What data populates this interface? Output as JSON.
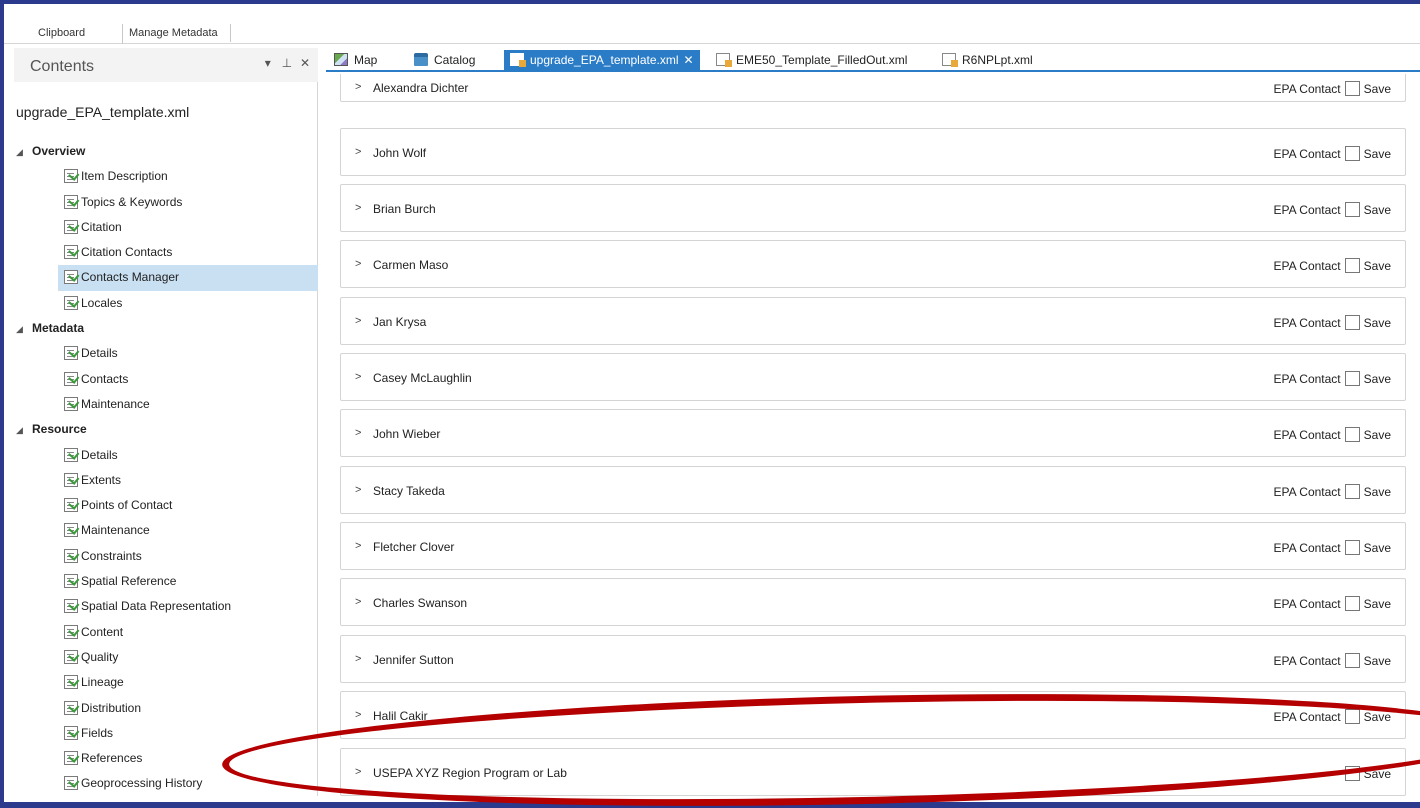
{
  "ribbon": {
    "groups": [
      "Clipboard",
      "Manage Metadata"
    ]
  },
  "contents_pane": {
    "title": "Contents",
    "controls": [
      "▾",
      "⊥",
      "✕"
    ],
    "document_name": "upgrade_EPA_template.xml",
    "tree": [
      {
        "type": "group",
        "label": "Overview"
      },
      {
        "type": "item",
        "label": "Item Description"
      },
      {
        "type": "item",
        "label": "Topics & Keywords"
      },
      {
        "type": "item",
        "label": "Citation"
      },
      {
        "type": "item",
        "label": "Citation Contacts"
      },
      {
        "type": "item",
        "label": "Contacts Manager",
        "selected": true
      },
      {
        "type": "item",
        "label": "Locales"
      },
      {
        "type": "group",
        "label": "Metadata"
      },
      {
        "type": "item",
        "label": "Details"
      },
      {
        "type": "item",
        "label": "Contacts"
      },
      {
        "type": "item",
        "label": "Maintenance"
      },
      {
        "type": "group",
        "label": "Resource"
      },
      {
        "type": "item",
        "label": "Details"
      },
      {
        "type": "item",
        "label": "Extents"
      },
      {
        "type": "item",
        "label": "Points of Contact"
      },
      {
        "type": "item",
        "label": "Maintenance"
      },
      {
        "type": "item",
        "label": "Constraints"
      },
      {
        "type": "item",
        "label": "Spatial Reference"
      },
      {
        "type": "item",
        "label": "Spatial Data Representation"
      },
      {
        "type": "item",
        "label": "Content"
      },
      {
        "type": "item",
        "label": "Quality"
      },
      {
        "type": "item",
        "label": "Lineage"
      },
      {
        "type": "item",
        "label": "Distribution"
      },
      {
        "type": "item",
        "label": "Fields"
      },
      {
        "type": "item",
        "label": "References"
      },
      {
        "type": "item",
        "label": "Geoprocessing History"
      }
    ]
  },
  "tabs": [
    {
      "label": "Map",
      "icon": "map-icon"
    },
    {
      "label": "Catalog",
      "icon": "catalog-icon"
    },
    {
      "label": "upgrade_EPA_template.xml",
      "icon": "xml-file-icon",
      "active": true,
      "close": "✕"
    },
    {
      "label": "EME50_Template_FilledOut.xml",
      "icon": "xml-file-icon"
    },
    {
      "label": "R6NPLpt.xml",
      "icon": "xml-file-icon"
    }
  ],
  "contacts": [
    {
      "name": "Alexandra Dichter",
      "epa_label": "EPA Contact",
      "save_label": "Save"
    },
    {
      "name": "John Wolf",
      "epa_label": "EPA Contact",
      "save_label": "Save"
    },
    {
      "name": "Brian Burch",
      "epa_label": "EPA Contact",
      "save_label": "Save"
    },
    {
      "name": "Carmen Maso",
      "epa_label": "EPA Contact",
      "save_label": "Save"
    },
    {
      "name": "Jan Krysa",
      "epa_label": "EPA Contact",
      "save_label": "Save"
    },
    {
      "name": "Casey McLaughlin",
      "epa_label": "EPA Contact",
      "save_label": "Save"
    },
    {
      "name": "John Wieber",
      "epa_label": "EPA Contact",
      "save_label": "Save"
    },
    {
      "name": "Stacy Takeda",
      "epa_label": "EPA Contact",
      "save_label": "Save"
    },
    {
      "name": "Fletcher Clover",
      "epa_label": "EPA Contact",
      "save_label": "Save"
    },
    {
      "name": "Charles Swanson",
      "epa_label": "EPA Contact",
      "save_label": "Save"
    },
    {
      "name": "Jennifer Sutton",
      "epa_label": "EPA Contact",
      "save_label": "Save"
    },
    {
      "name": "Halil Cakir",
      "epa_label": "EPA Contact",
      "save_label": "Save"
    },
    {
      "name": "USEPA XYZ Region Program or Lab",
      "epa_label": "",
      "save_label": "Save"
    }
  ],
  "chevron": ">",
  "colors": {
    "accent": "#2a7cc7",
    "frame": "#2b3a8c",
    "annotation": "#b40000",
    "selected_row": "#c9dff2"
  }
}
